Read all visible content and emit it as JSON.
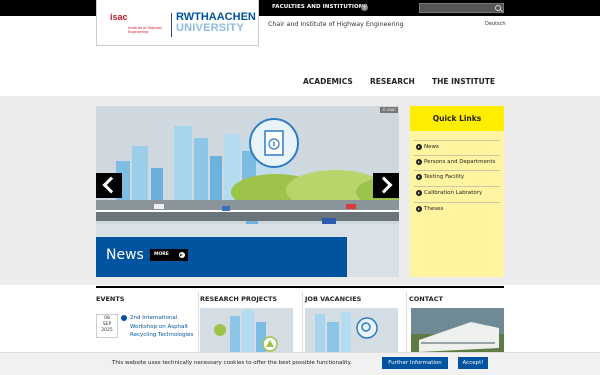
{
  "topbar": {
    "faculties_label": "FACULTIES AND INSTITUTIONS",
    "faculties_plus": "+",
    "search_placeholder": ""
  },
  "logo": {
    "isac_text": "isac",
    "isac_sub": "Institute of Highway Engineering",
    "rwth_line1": "RWTHAACHEN",
    "rwth_line2": "UNIVERSITY"
  },
  "header": {
    "institute_name": "Chair and Institute of Highway Engineering",
    "language": "Deutsch"
  },
  "nav": {
    "items": [
      "ACADEMICS",
      "RESEARCH",
      "THE INSTITUTE"
    ]
  },
  "slider": {
    "badge": "© ISAC",
    "caption": "News",
    "more_label": "MORE"
  },
  "quick_links": {
    "title": "Quick Links",
    "items": [
      "News",
      "Persons and Departments",
      "Testing Facility",
      "Calibration Labratory",
      "Theses"
    ]
  },
  "sections": {
    "events": "EVENTS",
    "research": "RESEARCH PROJECTS",
    "jobs": "JOB VACANCIES",
    "contact": "CONTACT"
  },
  "event": {
    "day": "08",
    "month": "SEP",
    "year": "2025",
    "title": "2nd International Workshop on Asphalt Recycling Technologies"
  },
  "cookie": {
    "text": "This website uses technically necessary cookies to offer the best possible functionality.",
    "info_label": "Further Information",
    "accept_label": "Accept!"
  },
  "colors": {
    "rwth_blue": "#00539f",
    "isac_red": "#c7162a",
    "quick_yellow": "#ffed00"
  }
}
